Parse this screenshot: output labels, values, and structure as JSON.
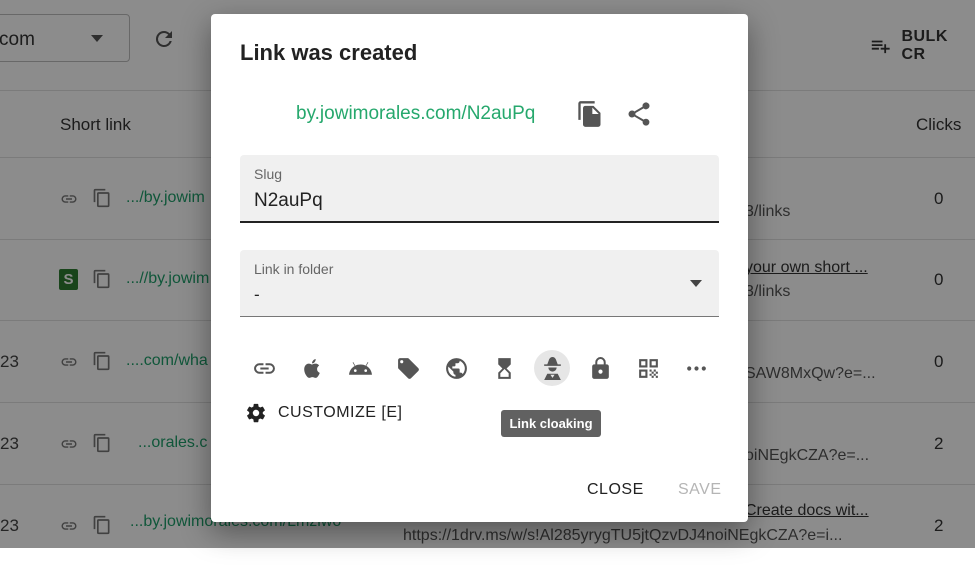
{
  "header": {
    "domain_select_value": "com",
    "bulk_label": "BULK CR"
  },
  "table": {
    "columns": {
      "short_link": "Short link",
      "clicks": "Clicks"
    },
    "rows": [
      {
        "num": "",
        "link": ".../by.jowim",
        "dest1": "",
        "dest2": "3/links",
        "clicks": "0"
      },
      {
        "num": "",
        "link": "...//by.jowim",
        "dest1": "your own short ...",
        "dest2": "3/links",
        "clicks": "0"
      },
      {
        "num": "23",
        "link": "....com/wha",
        "dest1": "",
        "dest2": "SAW8MxQw?e=...",
        "clicks": "0"
      },
      {
        "num": "23",
        "link": "...orales.c",
        "dest1": "",
        "dest2": "oiNEgkCZA?e=...",
        "clicks": "2"
      },
      {
        "num": "23",
        "link": "...by.jowimorales.com/Lmzlwo",
        "dest1": "Create docs wit...",
        "dest2": "https://1drv.ms/w/s!Al285yrygTU5jtQzvDJ4noiNEgkCZA?e=i...",
        "clicks": "2"
      }
    ]
  },
  "dialog": {
    "title": "Link was created",
    "short_link": "by.jowimorales.com/N2auPq",
    "slug_label": "Slug",
    "slug_value": "N2auPq",
    "folder_label": "Link in folder",
    "folder_value": "-",
    "customize_label": "CUSTOMIZE [E]",
    "tooltip": "Link cloaking",
    "close_label": "CLOSE",
    "save_label": "SAVE"
  },
  "icons": [
    "link-icon",
    "apple-icon",
    "android-icon",
    "tag-icon",
    "globe-icon",
    "hourglass-icon",
    "spy-icon",
    "lock-icon",
    "qr-code-icon",
    "more-icon"
  ],
  "colors": {
    "accent_green": "#26a86d",
    "overlay": "rgba(0,0,0,0.45)"
  }
}
